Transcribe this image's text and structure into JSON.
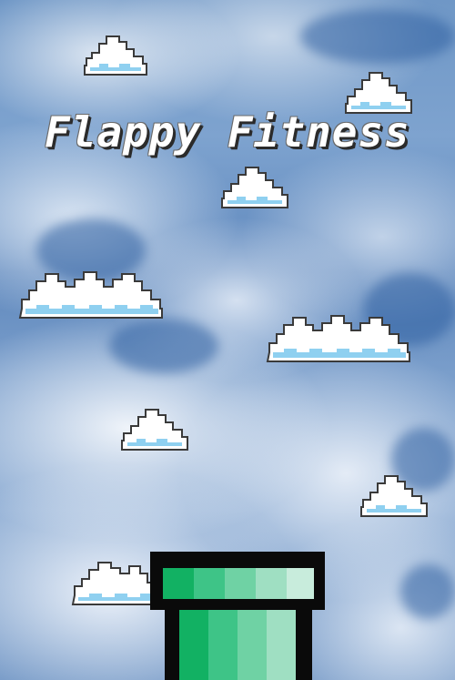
{
  "game": {
    "title": "Flappy Fitness"
  },
  "colors": {
    "pipe_outline": "#0a0a0a",
    "pipe_shades": [
      "#12b163",
      "#3ec487",
      "#6fd2a4",
      "#9fdfc2",
      "#c8ecdc"
    ],
    "cloud_fill": "#ffffff",
    "cloud_shadow": "#8fd0f0",
    "cloud_outline": "#3a3a3a"
  },
  "sprites": {
    "clouds": "pixel-cloud",
    "obstacle": "green-pipe"
  }
}
